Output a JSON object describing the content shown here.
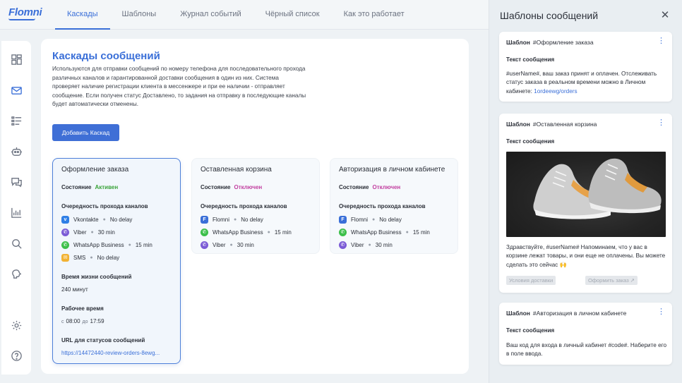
{
  "app": {
    "logo": "Flomni"
  },
  "nav": {
    "tabs": [
      {
        "label": "Каскады",
        "active": true
      },
      {
        "label": "Шаблоны",
        "active": false
      },
      {
        "label": "Журнал событий",
        "active": false
      },
      {
        "label": "Чёрный список",
        "active": false
      },
      {
        "label": "Как это работает",
        "active": false
      }
    ]
  },
  "sidebar": {
    "items": [
      {
        "icon": "dashboard-icon"
      },
      {
        "icon": "mail-icon",
        "active": true
      },
      {
        "icon": "list-icon"
      },
      {
        "icon": "bot-icon"
      },
      {
        "icon": "chat-icon"
      },
      {
        "icon": "chart-icon"
      },
      {
        "icon": "search-icon"
      },
      {
        "icon": "brain-icon"
      },
      {
        "icon": "settings-icon"
      },
      {
        "icon": "help-icon"
      }
    ]
  },
  "main": {
    "title": "Каскады сообщений",
    "description": "Используются для отправки сообщений по номеру телефона для последовательного прохода различных каналов и гарантированной доставки сообщения в один из них. Система проверяет наличие регистрации клиента в мессенжере и при ее наличии - отправляет сообщение. Если получен статус Доставлено, то задания на отправку в последующие каналы будет автоматически отменены.",
    "add_button": "Добавить Каскад",
    "status_label": "Состояние",
    "order_label": "Очередность прохода каналов",
    "cards": [
      {
        "title": "Оформление заказа",
        "status": "Активен",
        "active": true,
        "channels": [
          {
            "name": "Vkontakte",
            "delay": "No delay",
            "color": "#2f7fe6",
            "icon": "vk-icon"
          },
          {
            "name": "Viber",
            "delay": "30 min",
            "color": "#7b5bd6",
            "icon": "viber-icon"
          },
          {
            "name": "WhatsApp Business",
            "delay": "15 min",
            "color": "#3cbf4a",
            "icon": "whatsapp-icon"
          },
          {
            "name": "SMS",
            "delay": "No delay",
            "color": "#f2b233",
            "icon": "sms-icon"
          }
        ],
        "lifetime_label": "Время жизни сообщений",
        "lifetime_value": "240 минут",
        "worktime_label": "Рабочее время",
        "worktime_from_label": "с",
        "worktime_from": "08:00",
        "worktime_to_label": "до",
        "worktime_to": "17:59",
        "url_label": "URL для статусов сообщений",
        "url_value": "https://14472440-review-orders-8ewg..."
      },
      {
        "title": "Оставленная корзина",
        "status": "Отключен",
        "active": false,
        "channels": [
          {
            "name": "Flomni",
            "delay": "No delay",
            "color": "#3a6fd8",
            "icon": "flomni-icon"
          },
          {
            "name": "WhatsApp Business",
            "delay": "15 min",
            "color": "#3cbf4a",
            "icon": "whatsapp-icon"
          },
          {
            "name": "Viber",
            "delay": "30 min",
            "color": "#7b5bd6",
            "icon": "viber-icon"
          }
        ]
      },
      {
        "title": "Авторизация в личном кабинете",
        "status": "Отключен",
        "active": false,
        "channels": [
          {
            "name": "Flomni",
            "delay": "No delay",
            "color": "#3a6fd8",
            "icon": "flomni-icon"
          },
          {
            "name": "WhatsApp Business",
            "delay": "15 min",
            "color": "#3cbf4a",
            "icon": "whatsapp-icon"
          },
          {
            "name": "Viber",
            "delay": "30 min",
            "color": "#7b5bd6",
            "icon": "viber-icon"
          }
        ]
      }
    ]
  },
  "drawer": {
    "title": "Шаблоны сообщений",
    "close": "✕",
    "template_label": "Шаблон",
    "text_label": "Текст сообщения",
    "templates": [
      {
        "name": "#Оформление заказа",
        "text": "#userName#, ваш заказ принят и оплачен. Отслеживать статус заказа в реальном времени можно в Личном кабинете: ",
        "link": "1ordeewg/orders"
      },
      {
        "name": "#Оставленная корзина",
        "text": "Здравствуйте, #userName# Напоминаем, что у вас в корзине лежат товары, и они еще не оплачены. Вы можете сделать это сейчас 🙌",
        "buttons": [
          "Условия доставки",
          "Оформить заказ ↗"
        ]
      },
      {
        "name": "#Авторизация в личном кабинете",
        "text": "Ваш код для входа в личный кабинет #code#. Наберите его в поле ввода."
      }
    ]
  }
}
